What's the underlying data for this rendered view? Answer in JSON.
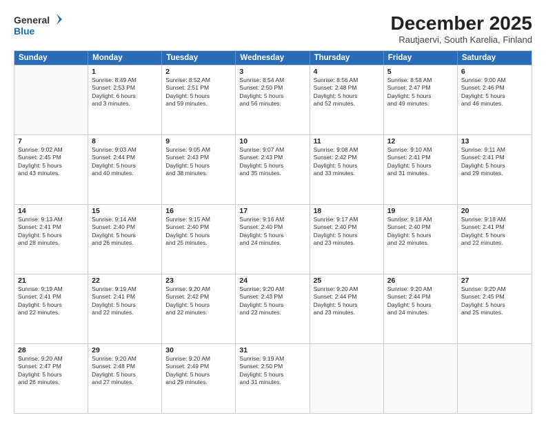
{
  "logo": {
    "line1": "General",
    "line2": "Blue"
  },
  "title": "December 2025",
  "subtitle": "Rautjaervi, South Karelia, Finland",
  "header_days": [
    "Sunday",
    "Monday",
    "Tuesday",
    "Wednesday",
    "Thursday",
    "Friday",
    "Saturday"
  ],
  "weeks": [
    [
      {
        "day": "",
        "info": "",
        "empty": true
      },
      {
        "day": "1",
        "info": "Sunrise: 8:49 AM\nSunset: 2:53 PM\nDaylight: 6 hours\nand 3 minutes."
      },
      {
        "day": "2",
        "info": "Sunrise: 8:52 AM\nSunset: 2:51 PM\nDaylight: 5 hours\nand 59 minutes."
      },
      {
        "day": "3",
        "info": "Sunrise: 8:54 AM\nSunset: 2:50 PM\nDaylight: 5 hours\nand 56 minutes."
      },
      {
        "day": "4",
        "info": "Sunrise: 8:56 AM\nSunset: 2:48 PM\nDaylight: 5 hours\nand 52 minutes."
      },
      {
        "day": "5",
        "info": "Sunrise: 8:58 AM\nSunset: 2:47 PM\nDaylight: 5 hours\nand 49 minutes."
      },
      {
        "day": "6",
        "info": "Sunrise: 9:00 AM\nSunset: 2:46 PM\nDaylight: 5 hours\nand 46 minutes."
      }
    ],
    [
      {
        "day": "7",
        "info": "Sunrise: 9:02 AM\nSunset: 2:45 PM\nDaylight: 5 hours\nand 43 minutes."
      },
      {
        "day": "8",
        "info": "Sunrise: 9:03 AM\nSunset: 2:44 PM\nDaylight: 5 hours\nand 40 minutes."
      },
      {
        "day": "9",
        "info": "Sunrise: 9:05 AM\nSunset: 2:43 PM\nDaylight: 5 hours\nand 38 minutes."
      },
      {
        "day": "10",
        "info": "Sunrise: 9:07 AM\nSunset: 2:43 PM\nDaylight: 5 hours\nand 35 minutes."
      },
      {
        "day": "11",
        "info": "Sunrise: 9:08 AM\nSunset: 2:42 PM\nDaylight: 5 hours\nand 33 minutes."
      },
      {
        "day": "12",
        "info": "Sunrise: 9:10 AM\nSunset: 2:41 PM\nDaylight: 5 hours\nand 31 minutes."
      },
      {
        "day": "13",
        "info": "Sunrise: 9:11 AM\nSunset: 2:41 PM\nDaylight: 5 hours\nand 29 minutes."
      }
    ],
    [
      {
        "day": "14",
        "info": "Sunrise: 9:13 AM\nSunset: 2:41 PM\nDaylight: 5 hours\nand 28 minutes."
      },
      {
        "day": "15",
        "info": "Sunrise: 9:14 AM\nSunset: 2:40 PM\nDaylight: 5 hours\nand 26 minutes."
      },
      {
        "day": "16",
        "info": "Sunrise: 9:15 AM\nSunset: 2:40 PM\nDaylight: 5 hours\nand 25 minutes."
      },
      {
        "day": "17",
        "info": "Sunrise: 9:16 AM\nSunset: 2:40 PM\nDaylight: 5 hours\nand 24 minutes."
      },
      {
        "day": "18",
        "info": "Sunrise: 9:17 AM\nSunset: 2:40 PM\nDaylight: 5 hours\nand 23 minutes."
      },
      {
        "day": "19",
        "info": "Sunrise: 9:18 AM\nSunset: 2:40 PM\nDaylight: 5 hours\nand 22 minutes."
      },
      {
        "day": "20",
        "info": "Sunrise: 9:18 AM\nSunset: 2:41 PM\nDaylight: 5 hours\nand 22 minutes."
      }
    ],
    [
      {
        "day": "21",
        "info": "Sunrise: 9:19 AM\nSunset: 2:41 PM\nDaylight: 5 hours\nand 22 minutes."
      },
      {
        "day": "22",
        "info": "Sunrise: 9:19 AM\nSunset: 2:41 PM\nDaylight: 5 hours\nand 22 minutes."
      },
      {
        "day": "23",
        "info": "Sunrise: 9:20 AM\nSunset: 2:42 PM\nDaylight: 5 hours\nand 22 minutes."
      },
      {
        "day": "24",
        "info": "Sunrise: 9:20 AM\nSunset: 2:43 PM\nDaylight: 5 hours\nand 22 minutes."
      },
      {
        "day": "25",
        "info": "Sunrise: 9:20 AM\nSunset: 2:44 PM\nDaylight: 5 hours\nand 23 minutes."
      },
      {
        "day": "26",
        "info": "Sunrise: 9:20 AM\nSunset: 2:44 PM\nDaylight: 5 hours\nand 24 minutes."
      },
      {
        "day": "27",
        "info": "Sunrise: 9:20 AM\nSunset: 2:45 PM\nDaylight: 5 hours\nand 25 minutes."
      }
    ],
    [
      {
        "day": "28",
        "info": "Sunrise: 9:20 AM\nSunset: 2:47 PM\nDaylight: 5 hours\nand 26 minutes."
      },
      {
        "day": "29",
        "info": "Sunrise: 9:20 AM\nSunset: 2:48 PM\nDaylight: 5 hours\nand 27 minutes."
      },
      {
        "day": "30",
        "info": "Sunrise: 9:20 AM\nSunset: 2:49 PM\nDaylight: 5 hours\nand 29 minutes."
      },
      {
        "day": "31",
        "info": "Sunrise: 9:19 AM\nSunset: 2:50 PM\nDaylight: 5 hours\nand 31 minutes."
      },
      {
        "day": "",
        "info": "",
        "empty": true
      },
      {
        "day": "",
        "info": "",
        "empty": true
      },
      {
        "day": "",
        "info": "",
        "empty": true
      }
    ]
  ]
}
